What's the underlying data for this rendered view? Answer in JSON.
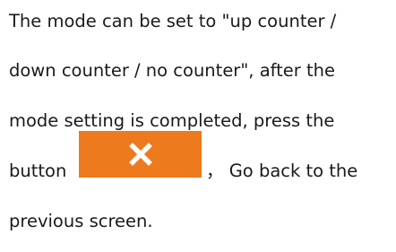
{
  "document": {
    "line1": "The mode can be set to \"up counter /",
    "line2": "down counter / no counter\", after the",
    "line3": "mode setting is completed, press the",
    "line4_before": "button",
    "line4_after": "， Go back to the",
    "line5": "previous screen."
  },
  "button": {
    "icon": "close-icon",
    "color": "#ee7a1e",
    "icon_color": "#ffffff"
  }
}
